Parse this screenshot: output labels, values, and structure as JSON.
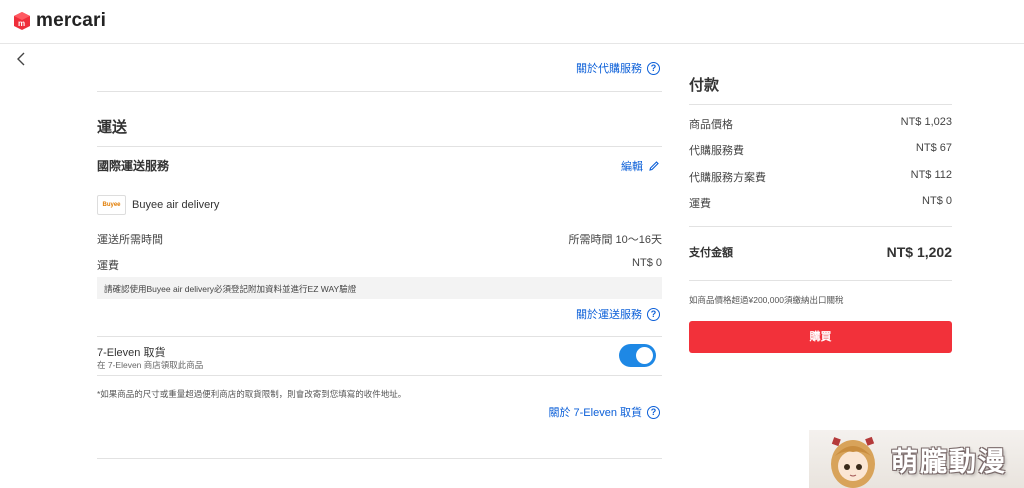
{
  "header": {
    "logo_text": "mercari"
  },
  "left": {
    "about_proxy_link": "關於代購服務",
    "shipping_title": "運送",
    "intl_shipping_label": "國際運送服務",
    "edit_link": "編輯",
    "buyee_logo_text": "Buyee",
    "carrier_name": "Buyee air delivery",
    "transit_time_label": "運送所需時間",
    "transit_time_value": "所需時間 10～16天",
    "shipping_fee_label": "運費",
    "shipping_fee_value": "NT$ 0",
    "notice_text": "請確認使用Buyee air delivery必須登記附加資料並進行EZ WAY驗證",
    "about_shipping_link": "關於運送服務",
    "seven_title": "7-Eleven 取貨",
    "seven_sub": "在 7-Eleven 商店領取此商品",
    "seven_toggle_on": true,
    "size_note": "*如果商品的尺寸或重量超過便利商店的取貨限制，則會改寄到您填寫的收件地址。",
    "about_seven_link": "關於 7-Eleven 取貨"
  },
  "payment": {
    "title": "付款",
    "rows": [
      {
        "label": "商品價格",
        "value": "NT$ 1,023"
      },
      {
        "label": "代購服務費",
        "value": "NT$ 67"
      },
      {
        "label": "代購服務方案費",
        "value": "NT$ 112"
      },
      {
        "label": "運費",
        "value": "NT$ 0"
      }
    ],
    "total_label": "支付金額",
    "total_value": "NT$ 1,202",
    "customs_note": "如商品價格超過¥200,000須繳納出口關稅",
    "buy_button": "購買"
  },
  "watermark": {
    "text": "萌朧動漫"
  },
  "colors": {
    "accent_blue": "#0b5fd8",
    "buy_red": "#f2313a",
    "toggle_blue": "#1e88e5"
  }
}
